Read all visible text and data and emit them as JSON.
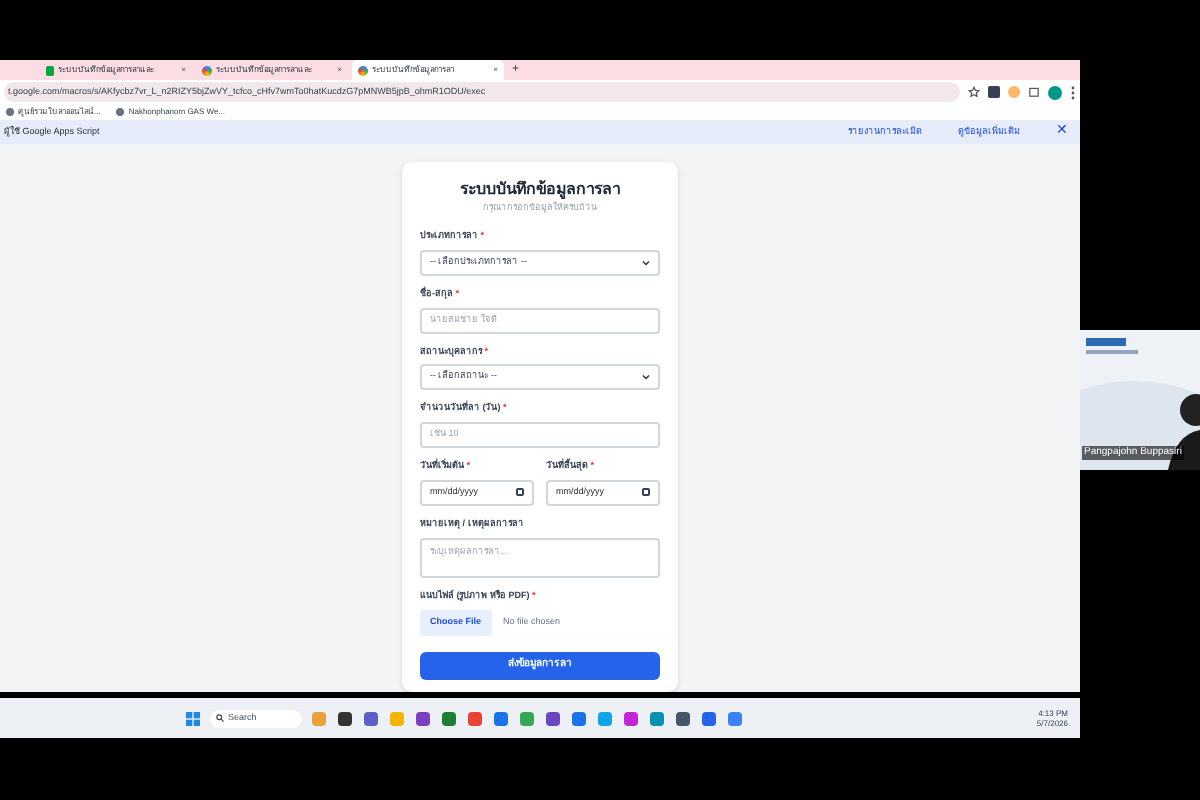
{
  "browser": {
    "tabs": [
      {
        "title": "ระบบบันทึกข้อมูลการลาและ",
        "kind": "sheets",
        "selected": false,
        "close": "×"
      },
      {
        "title": "ระบบบันทึกข้อมูลการลาและ",
        "kind": "script",
        "selected": false,
        "close": "×"
      },
      {
        "title": "ระบบบันทึกข้อมูลการลา",
        "kind": "script",
        "selected": true,
        "close": "×"
      }
    ],
    "new_tab": "+",
    "url": "t.google.com/macros/s/AKfycbz7vr_L_n2RIZY5bjZwVY_tcfco_cHfv7wmTo0hatKucdzG7pMNWB5jpB_ohmR1ODU/exec",
    "bookmarks": [
      "ศูนย์รวมใบลาออนไลน์...",
      "Nakhonphanom GAS We..."
    ],
    "info_bar": {
      "text": "ผู้ใช้ Google Apps Script",
      "links": [
        "รายงานการละเมิด",
        "ดูข้อมูลเพิ่มเติม"
      ],
      "close": "✕"
    }
  },
  "form": {
    "title": "ระบบบันทึกข้อมูลการลา",
    "subtitle": "กรุณากรอกข้อมูลให้ครบถ้วน",
    "fields": [
      {
        "kind": "select",
        "label": "ประเภทการลา",
        "required_mark": "*",
        "value": "-- เลือกประเภทการลา --"
      },
      {
        "kind": "text",
        "label": "ชื่อ-สกุล",
        "required_mark": "*",
        "placeholder": "นายสมชาย ใจดี"
      },
      {
        "kind": "select",
        "label": "สถานะบุคลากร",
        "required_mark": "*",
        "value": "-- เลือกสถานะ --"
      },
      {
        "kind": "text",
        "label": "จำนวนวันที่ลา (วัน)",
        "required_mark": "*",
        "placeholder": "เช่น 10"
      },
      {
        "kind": "dates",
        "items": [
          {
            "label": "วันที่เริ่มต้น",
            "required_mark": "*",
            "value": "mm/dd/yyyy"
          },
          {
            "label": "วันที่สิ้นสุด",
            "required_mark": "*",
            "value": "mm/dd/yyyy"
          }
        ]
      },
      {
        "kind": "textarea",
        "label": "หมายเหตุ / เหตุผลการลา",
        "placeholder": "ระบุเหตุผลการลา..."
      },
      {
        "kind": "file",
        "label": "แนบไฟล์ (รูปภาพ หรือ PDF)",
        "required_mark": "*",
        "button": "Choose File",
        "status": "No file chosen"
      }
    ],
    "submit": "ส่งข้อมูลการลา"
  },
  "video_tile": {
    "name": "Pangpajohn Buppasiri"
  },
  "taskbar": {
    "search": "Search",
    "time": "4:13 PM",
    "date": "5/7/2026"
  }
}
